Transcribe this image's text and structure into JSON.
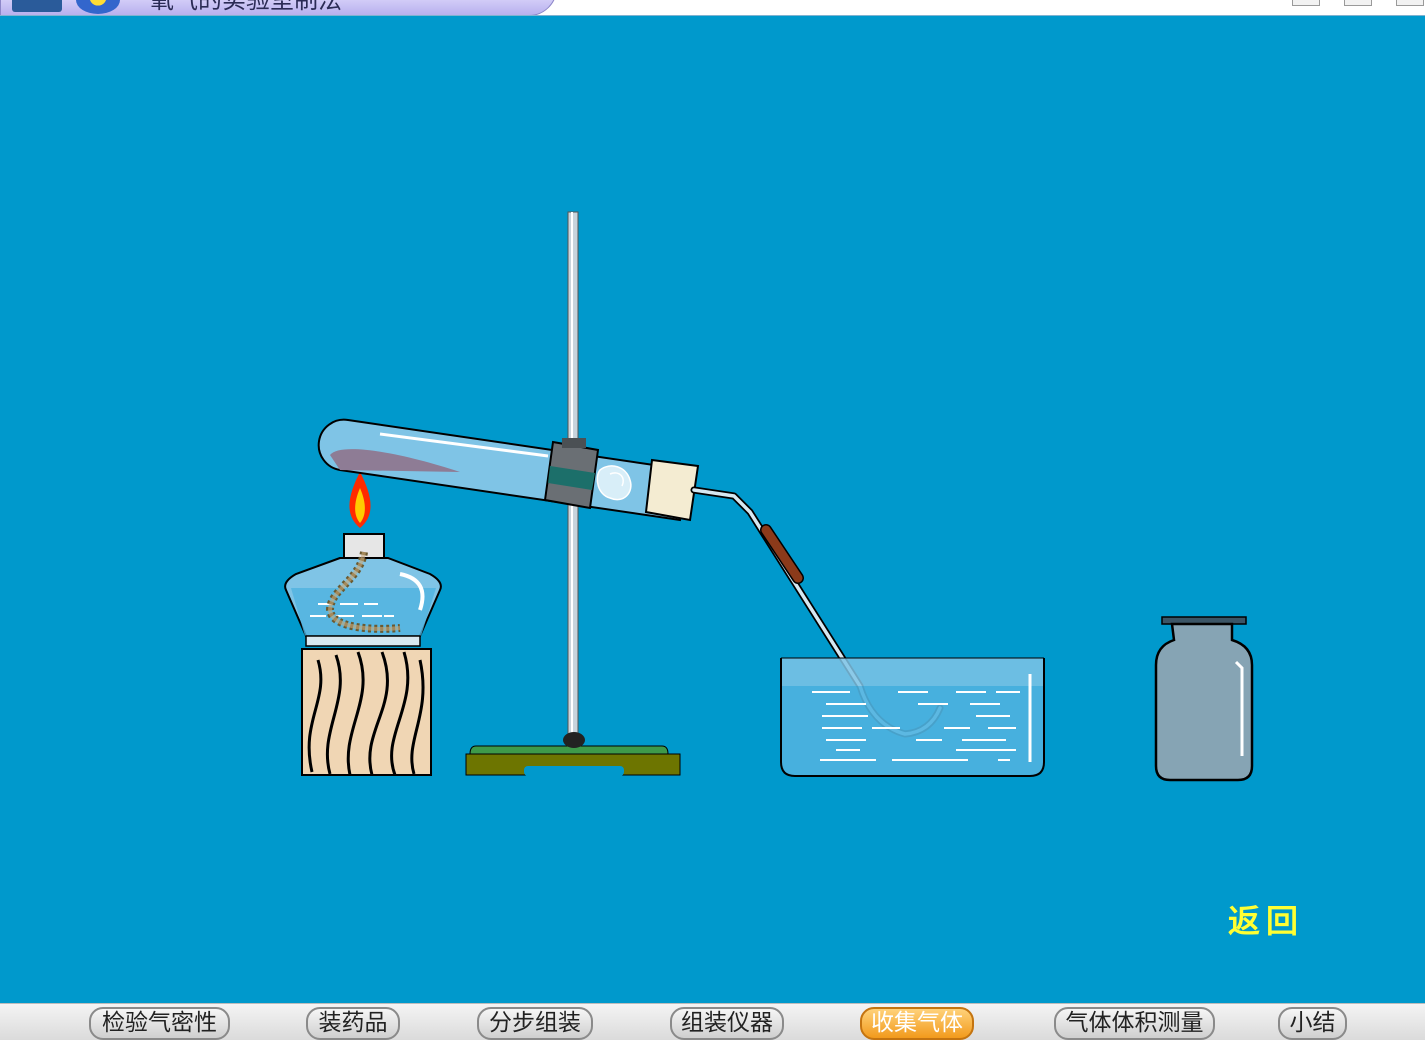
{
  "window": {
    "title": "氧气的实验室制法"
  },
  "scene": {
    "return_label": "返回",
    "colors": {
      "background": "#0099cc",
      "glass": "#7fc4e6",
      "water": "#4fb3e0",
      "wood": "#f0d6b4",
      "stand_base": "#6d7500",
      "rubber_tube": "#8b3a1a",
      "return_text": "#ffff33"
    },
    "icons": [
      "alcohol-lamp-icon",
      "flame-icon",
      "test-tube-icon",
      "iron-stand-icon",
      "clamp-icon",
      "delivery-tube-icon",
      "water-trough-icon",
      "gas-bottle-icon",
      "wooden-block-icon"
    ]
  },
  "nav": {
    "items": [
      {
        "label": "检验气密性",
        "active": false
      },
      {
        "label": "装药品",
        "active": false
      },
      {
        "label": "分步组装",
        "active": false
      },
      {
        "label": "组装仪器",
        "active": false
      },
      {
        "label": "收集气体",
        "active": true
      },
      {
        "label": "气体体积测量",
        "active": false
      },
      {
        "label": "小结",
        "active": false
      }
    ]
  }
}
